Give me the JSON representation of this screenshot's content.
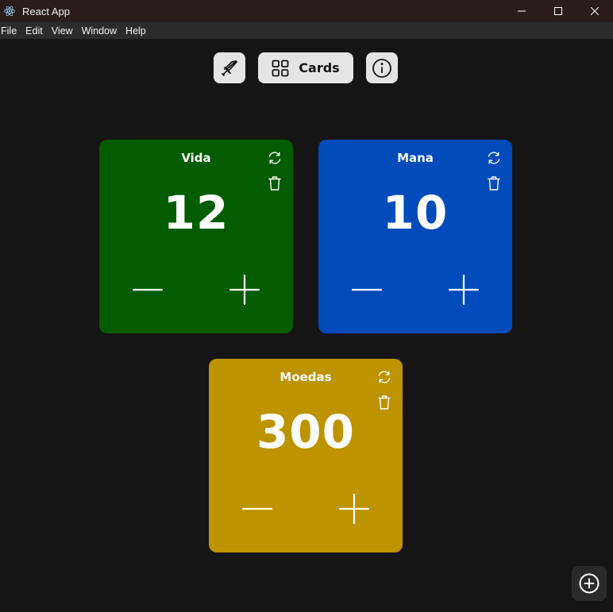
{
  "window": {
    "title": "React App",
    "app_icon": "react-atom-icon",
    "controls": [
      "minimize-icon",
      "maximize-icon",
      "close-icon"
    ]
  },
  "menu": {
    "items": [
      "File",
      "Edit",
      "View",
      "Window",
      "Help"
    ]
  },
  "toolbar": {
    "sword_icon": "sword-icon",
    "cards_icon": "grid-icon",
    "cards_label": "Cards",
    "info_icon": "info-icon"
  },
  "cards": [
    {
      "title": "Vida",
      "value": "12",
      "color": "#035d00"
    },
    {
      "title": "Mana",
      "value": "10",
      "color": "#014bbb"
    },
    {
      "title": "Moedas",
      "value": "300",
      "color": "#bd9300"
    }
  ],
  "card_icons": {
    "reset": "refresh-icon",
    "delete": "trash-icon",
    "decrement": "minus-icon",
    "increment": "plus-icon"
  },
  "fab": {
    "icon": "add-circle-icon"
  },
  "colors": {
    "background": "#161515",
    "titlebar": "#2b1c1c",
    "menubar": "#2b2b2b",
    "toolbar_button": "#e4e4e4"
  }
}
